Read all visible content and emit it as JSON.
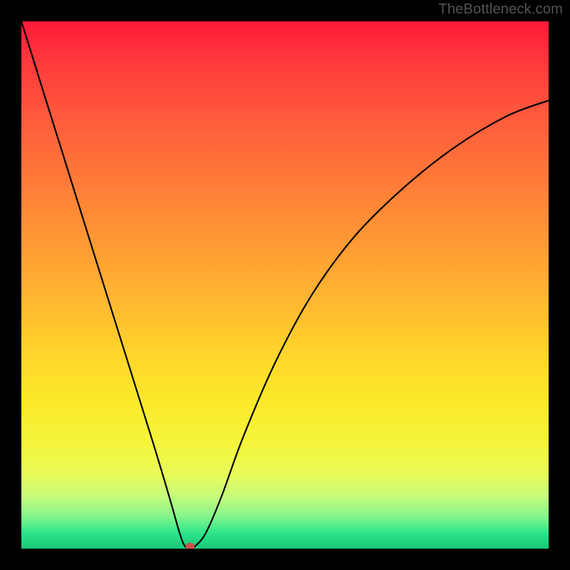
{
  "watermark": "TheBottleneck.com",
  "colors": {
    "background": "#000000",
    "gradient_top": "#ff1a3a",
    "gradient_bottom": "#18c878",
    "curve": "#000000",
    "marker": "#c9534a"
  },
  "chart_data": {
    "type": "line",
    "title": "",
    "xlabel": "",
    "ylabel": "",
    "xlim": [
      0,
      100
    ],
    "ylim": [
      0,
      100
    ],
    "grid": false,
    "x": [
      0,
      5,
      10,
      15,
      20,
      25,
      28,
      30,
      31,
      32,
      33,
      35,
      38,
      42,
      48,
      55,
      63,
      72,
      82,
      92,
      100
    ],
    "values": [
      100,
      84,
      68,
      52,
      36,
      20,
      10,
      3,
      0.5,
      0,
      0.5,
      3,
      10,
      21,
      35,
      48,
      59,
      68,
      76,
      82,
      85
    ],
    "marker": {
      "x": 32,
      "y": 0
    },
    "note": "V-shaped curve with vertex near x≈32 at y=0; left branch is steep/linear from (0,100) to vertex; right branch rises concavely toward ~85 at x=100. Values are read off the plot relative to its 0–100 vertical extent."
  }
}
